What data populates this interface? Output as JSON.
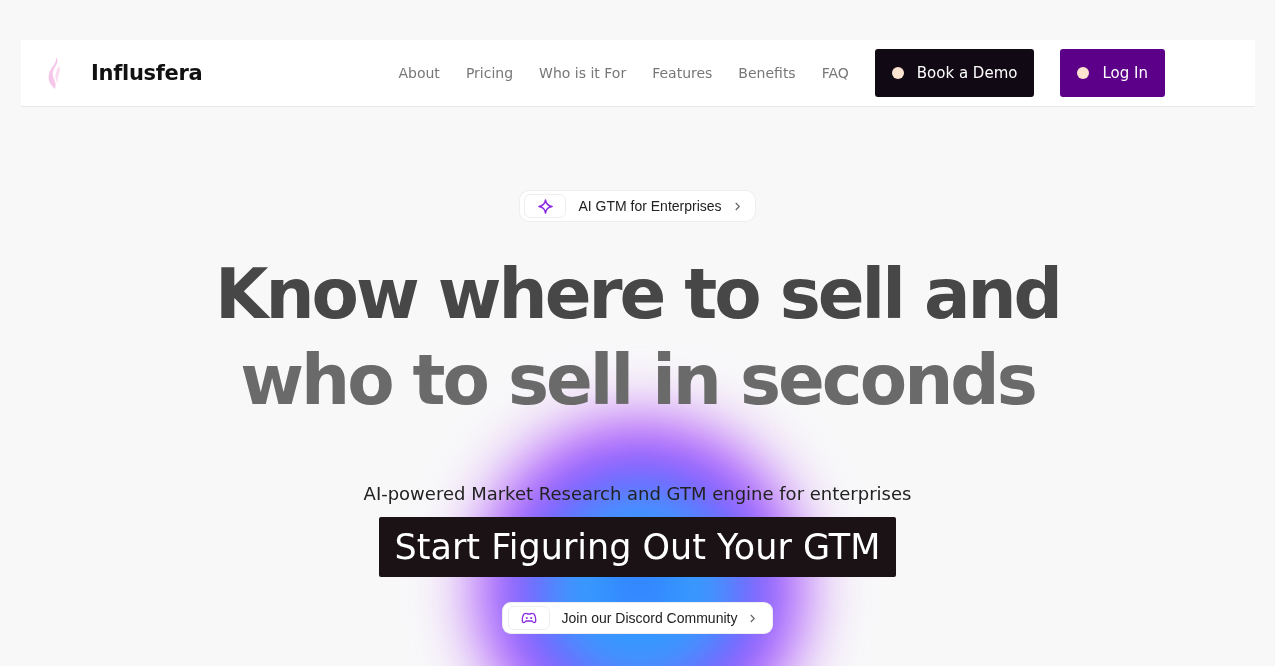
{
  "brand": {
    "name": "Influsfera"
  },
  "nav": {
    "links": [
      "About",
      "Pricing",
      "Who is it For",
      "Features",
      "Benefits",
      "FAQ"
    ],
    "buttons": [
      {
        "label": "Book a Demo",
        "kind": "dark"
      },
      {
        "label": "Log In",
        "kind": "purple"
      }
    ]
  },
  "hero": {
    "badge": "AI GTM for Enterprises",
    "headline_lines": [
      "Know where to sell and",
      "who to sell in seconds"
    ],
    "subtitle": "AI-powered Market Research and GTM engine for enterprises",
    "cta": "Start Figuring Out Your GTM",
    "community_link": "Join our Discord Community"
  }
}
